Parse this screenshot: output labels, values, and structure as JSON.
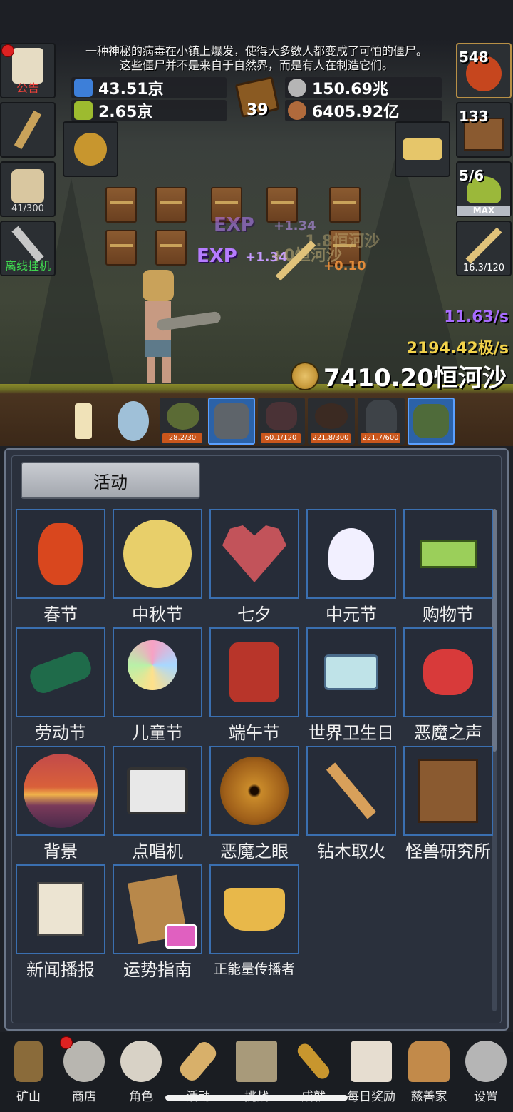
{
  "story": {
    "line1": "一种神秘的病毒在小镇上爆发，使得大多数人都变成了可怕的僵尸。",
    "line2": "这些僵尸并不是来自于自然界，而是有人在制造它们。"
  },
  "resources": {
    "blue_potion": "43.51京",
    "green_potion": "2.65京",
    "book_count": "39",
    "silver": "150.69兆",
    "meat": "6405.92亿"
  },
  "left_side": {
    "notice_label": "公告",
    "capacity": "41/300",
    "offline_label": "离线挂机"
  },
  "right_side": {
    "potion_count": "548",
    "chest_count": "133",
    "slime_count": "5/6",
    "slime_max": "MAX",
    "sword_count": "16.3/120"
  },
  "combat": {
    "exp1": "EXP",
    "exp1_gain": "+1.34",
    "exp2": "EXP",
    "exp2_gain": "+1.34",
    "coin_float1": "1.8恒河沙",
    "coin_float2": "+0恒河沙",
    "orange_gain": "+0.10"
  },
  "rates": {
    "exp_rate": "11.63/s",
    "coin_rate": "2194.42极/s",
    "total_coins": "7410.20恒河沙"
  },
  "monsters": [
    {
      "hp": ""
    },
    {
      "hp": ""
    },
    {
      "hp": "28.2/30"
    },
    {
      "hp": ""
    },
    {
      "hp": "60.1/120"
    },
    {
      "hp": "221.8/300"
    },
    {
      "hp": "221.7/600"
    },
    {
      "hp": ""
    }
  ],
  "panel": {
    "tab_label": "活动",
    "events": [
      "春节",
      "中秋节",
      "七夕",
      "中元节",
      "购物节",
      "劳动节",
      "儿童节",
      "端午节",
      "世界卫生日",
      "恶魔之声",
      "背景",
      "点唱机",
      "恶魔之眼",
      "钻木取火",
      "怪兽研究所",
      "新闻播报",
      "运势指南",
      "正能量传播者"
    ]
  },
  "nav": [
    "矿山",
    "商店",
    "角色",
    "活动",
    "挑战",
    "成就",
    "每日奖励",
    "慈善家",
    "设置"
  ],
  "colors": {
    "accent_blue": "#3a6fb0",
    "exp_purple": "#b67cff",
    "coin_gold": "#f2d24a"
  }
}
